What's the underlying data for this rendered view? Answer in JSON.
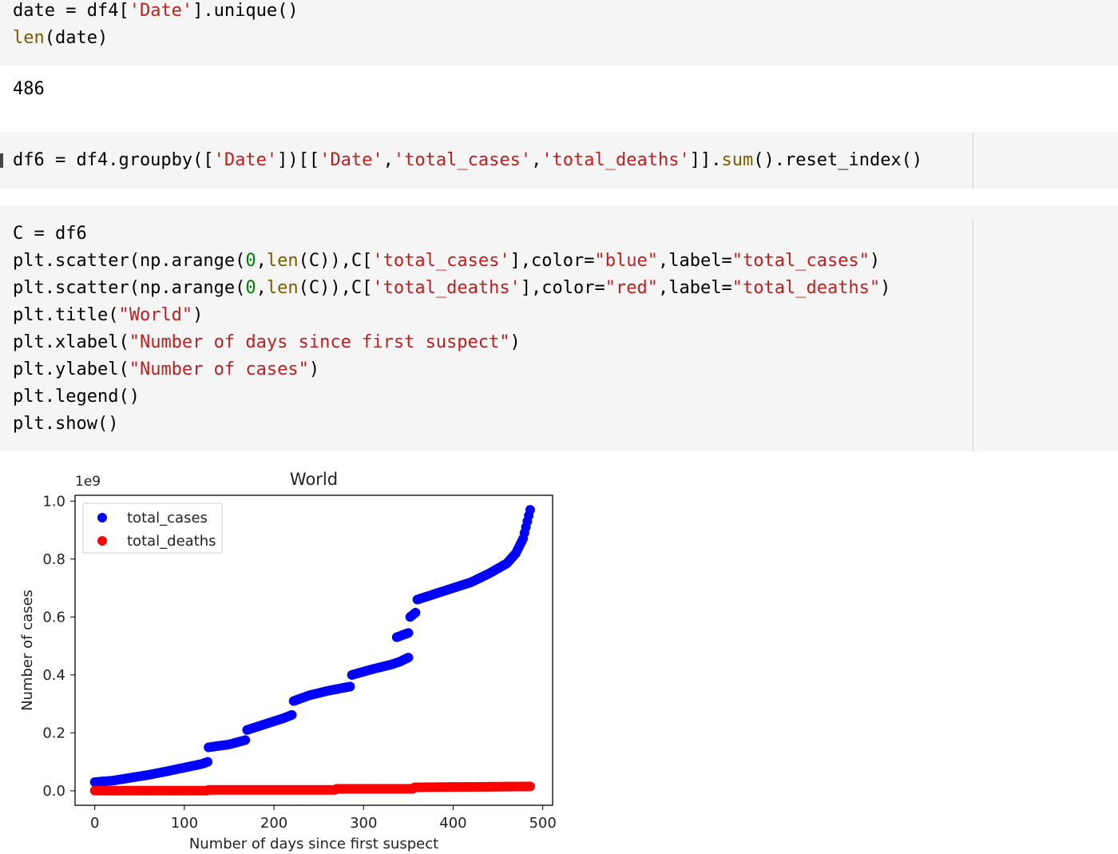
{
  "cells": [
    {
      "lines": [
        [
          [
            "date = df4[",
            ""
          ],
          [
            "'Date'",
            "str"
          ],
          [
            "].unique()",
            ""
          ]
        ],
        [
          [
            "len",
            "bi"
          ],
          [
            "(date)",
            ""
          ]
        ]
      ],
      "output": "486"
    },
    {
      "lines": [
        [
          [
            "df6 = df4.groupby([",
            ""
          ],
          [
            "'Date'",
            "str"
          ],
          [
            "])[[",
            ""
          ],
          [
            "'Date'",
            "str"
          ],
          [
            ",",
            ""
          ],
          [
            "'total_cases'",
            "str"
          ],
          [
            ",",
            ""
          ],
          [
            "'total_deaths'",
            "str"
          ],
          [
            "]].",
            ""
          ],
          [
            "sum",
            "bi"
          ],
          [
            "().reset_index()",
            ""
          ]
        ]
      ]
    },
    {
      "lines": [
        [
          [
            "C = df6",
            ""
          ]
        ],
        [
          [
            "plt.scatter(np.arange(",
            ""
          ],
          [
            "0",
            "num"
          ],
          [
            ",",
            ""
          ],
          [
            "len",
            "bi"
          ],
          [
            "(C)),C[",
            ""
          ],
          [
            "'total_cases'",
            "str"
          ],
          [
            "],color=",
            ""
          ],
          [
            "\"blue\"",
            "str"
          ],
          [
            ",label=",
            ""
          ],
          [
            "\"total_cases\"",
            "str"
          ],
          [
            ")",
            ""
          ]
        ],
        [
          [
            "plt.scatter(np.arange(",
            ""
          ],
          [
            "0",
            "num"
          ],
          [
            ",",
            ""
          ],
          [
            "len",
            "bi"
          ],
          [
            "(C)),C[",
            ""
          ],
          [
            "'total_deaths'",
            "str"
          ],
          [
            "],color=",
            ""
          ],
          [
            "\"red\"",
            "str"
          ],
          [
            ",label=",
            ""
          ],
          [
            "\"total_deaths\"",
            "str"
          ],
          [
            ")",
            ""
          ]
        ],
        [
          [
            "plt.title(",
            ""
          ],
          [
            "\"World\"",
            "str"
          ],
          [
            ")",
            ""
          ]
        ],
        [
          [
            "plt.xlabel(",
            ""
          ],
          [
            "\"Number of days since first suspect\"",
            "str"
          ],
          [
            ")",
            ""
          ]
        ],
        [
          [
            "plt.ylabel(",
            ""
          ],
          [
            "\"Number of cases\"",
            "str"
          ],
          [
            ")",
            ""
          ]
        ],
        [
          [
            "plt.legend()",
            ""
          ]
        ],
        [
          [
            "plt.show()",
            ""
          ]
        ]
      ]
    }
  ],
  "colors": {
    "string": "#ba2121",
    "number": "#008000",
    "builtin": "#7a5c00",
    "cell_bg": "#f5f5f5"
  },
  "chart_data": {
    "type": "scatter",
    "title": "World",
    "xlabel": "Number of days since first suspect",
    "ylabel": "Number of cases",
    "offset_text": "1e9",
    "xlim": [
      -22,
      511
    ],
    "ylim": [
      -0.05,
      1.02
    ],
    "xticks": [
      0,
      100,
      200,
      300,
      400,
      500
    ],
    "yticks": [
      0.0,
      0.2,
      0.4,
      0.6,
      0.8,
      1.0
    ],
    "ytick_labels": [
      "0.0",
      "0.2",
      "0.4",
      "0.6",
      "0.8",
      "1.0"
    ],
    "legend_position": "upper left",
    "series": [
      {
        "name": "total_cases",
        "color": "blue",
        "points": [
          [
            0,
            0.03
          ],
          [
            20,
            0.035
          ],
          [
            40,
            0.045
          ],
          [
            60,
            0.055
          ],
          [
            80,
            0.067
          ],
          [
            100,
            0.08
          ],
          [
            120,
            0.093
          ],
          [
            126,
            0.1
          ],
          [
            127,
            0.15
          ],
          [
            150,
            0.16
          ],
          [
            168,
            0.175
          ],
          [
            170,
            0.21
          ],
          [
            190,
            0.23
          ],
          [
            210,
            0.25
          ],
          [
            220,
            0.262
          ],
          [
            222,
            0.31
          ],
          [
            240,
            0.33
          ],
          [
            260,
            0.345
          ],
          [
            285,
            0.36
          ],
          [
            287,
            0.4
          ],
          [
            310,
            0.42
          ],
          [
            330,
            0.435
          ],
          [
            340,
            0.445
          ],
          [
            350,
            0.46
          ],
          [
            337,
            0.53
          ],
          [
            350,
            0.545
          ],
          [
            352,
            0.6
          ],
          [
            358,
            0.615
          ],
          [
            360,
            0.66
          ],
          [
            380,
            0.68
          ],
          [
            400,
            0.7
          ],
          [
            420,
            0.72
          ],
          [
            440,
            0.75
          ],
          [
            460,
            0.785
          ],
          [
            470,
            0.82
          ],
          [
            478,
            0.87
          ],
          [
            486,
            0.97
          ]
        ]
      },
      {
        "name": "total_deaths",
        "color": "red",
        "points": [
          [
            0,
            0.0005
          ],
          [
            125,
            0.0005
          ],
          [
            127,
            0.003
          ],
          [
            268,
            0.003
          ],
          [
            270,
            0.007
          ],
          [
            355,
            0.007
          ],
          [
            357,
            0.012
          ],
          [
            486,
            0.015
          ]
        ]
      }
    ]
  }
}
